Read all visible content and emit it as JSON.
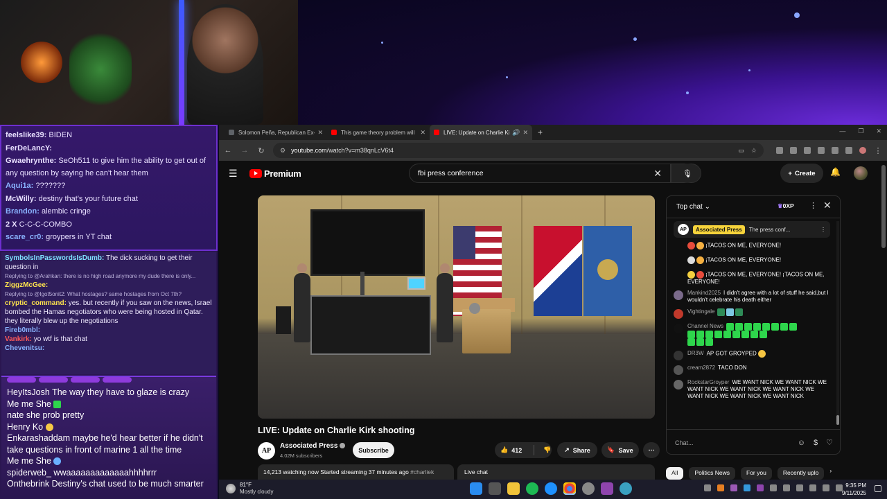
{
  "stream_chat_top": [
    {
      "user": "feelslike39:",
      "text": "BIDEN",
      "color": "#ffffff"
    },
    {
      "user": "FerDeLancY:",
      "text": "",
      "color": "#ffffff"
    },
    {
      "user": "Gwaehrynthe:",
      "text": "SeOh511 to give him the ability to get out of any question by saying he can't hear them",
      "color": "#ffffff"
    },
    {
      "user": "Aqui1a:",
      "text": "???????",
      "color": "#8ab4ff"
    },
    {
      "user": "McWilly:",
      "text": "destiny that's your future chat",
      "color": "#ffffff"
    },
    {
      "user": "Brandon:",
      "text": "alembic cringe",
      "color": "#8ab4ff"
    },
    {
      "user": "2 X",
      "text": "C-C-C-COMBO",
      "color": "#ffffff"
    },
    {
      "user": "scare_cr0:",
      "text": "groypers in YT chat",
      "color": "#8ab4ff"
    }
  ],
  "stream_chat_mid": [
    {
      "user": "SymbolsInPasswordsIsDumb:",
      "text": "The dick sucking to get their question in",
      "color": "#7fe0ff"
    },
    {
      "reply": "Replying to @Arahkan: there is no high road anymore my dude there is only..."
    },
    {
      "user": "ZiggzMcGee:",
      "text": "",
      "color": "#ffe44d"
    },
    {
      "reply": "Replying to @Igot5onit2: What hostages? same hostages from Oct 7th?"
    },
    {
      "user": "cryptic_command:",
      "text": "yes. but recently if you saw on the news, Israel bombed the Hamas negotiators who were being hosted in Qatar. they literally blew up the negotiations",
      "color": "#ffe44d"
    },
    {
      "user": "Fireb0mbl:",
      "text": "",
      "color": "#8ab4ff"
    },
    {
      "user": "Vankirk:",
      "text": "yo wtf is that chat",
      "color": "#ff5a5a"
    },
    {
      "user": "Chevenitsu:",
      "text": "",
      "color": "#8ab4ff"
    }
  ],
  "stream_chat_bottom": [
    {
      "user": "HeyItsJosh",
      "text": "The way they have to glaze is crazy"
    },
    {
      "user": "Me me She",
      "text": ""
    },
    {
      "user": "nate",
      "text": "she prob pretty"
    },
    {
      "user": "Henry Ko",
      "text": ""
    },
    {
      "user": "Enkarashaddam",
      "text": "maybe he'd hear better if he didn't take questions in front of marine 1 all the time"
    },
    {
      "user": "Me me She",
      "text": ""
    },
    {
      "user": "spiderweb_",
      "text": "wwaaaaaaaaaaaaahhhhrrr"
    },
    {
      "user": "Onthebrink",
      "text": "Destiny's chat used to be much smarter"
    }
  ],
  "tabs": [
    {
      "title": "Solomon Peña, Republican Ex-C",
      "favicon_color": "#5f6368"
    },
    {
      "title": "This game theory problem will",
      "favicon_color": "#ff0000"
    },
    {
      "title": "LIVE: Update on Charlie Kirk",
      "favicon_color": "#ff0000"
    }
  ],
  "url": {
    "site": "youtube.com",
    "path": "/watch?v=m38qnLcV6t4"
  },
  "youtube": {
    "logo_text": "Premium",
    "search_value": "fbi press conference",
    "create_label": "Create",
    "video_title": "LIVE: Update on Charlie Kirk shooting",
    "channel_name": "Associated Press",
    "channel_logo": "AP",
    "subscribers": "4.02M subscribers",
    "subscribe_label": "Subscribe",
    "likes": "412",
    "share_label": "Share",
    "save_label": "Save",
    "description": "14,213 watching now  Started streaming 37 minutes ago",
    "description_tag": "#charliek",
    "live_chat_label": "Live chat",
    "chips": [
      "All",
      "Politics News",
      "For you",
      "Recently uplo"
    ]
  },
  "live_chat": {
    "mode": "Top chat",
    "xp": "0XP",
    "pinned_name": "Associated Press",
    "pinned_text": "The press conf...",
    "messages": [
      {
        "user": "",
        "text": "¡TACOS ON ME, EVERYONE!",
        "avatar": "#0f0f0f"
      },
      {
        "user": "",
        "text": "¡TACOS ON ME, EVERYONE!",
        "avatar": "#0f0f0f"
      },
      {
        "user": "",
        "text": "¡TACOS ON ME, EVERYONE! ¡TACOS ON ME, EVERYONE!",
        "avatar": "#0f0f0f"
      },
      {
        "user": "Mankind2025",
        "text": "I didn't agree with a lot of stuff he said,but I wouldn't celebrate his death either",
        "avatar": "#7a6a8a"
      },
      {
        "user": "Vightingale",
        "text": "",
        "avatar": "#c0392b"
      },
      {
        "user": "Channel News",
        "text": "",
        "avatar": "#111111"
      },
      {
        "user": "DR3W",
        "text": "AP GOT GROYPED",
        "avatar": "#333333"
      },
      {
        "user": "cream2872",
        "text": "TACO DON",
        "avatar": "#555555"
      },
      {
        "user": "RockstarGroyper",
        "text": "WE WANT NICK WE WANT NICK WE WANT NICK WE WANT NICK WE WANT NICK WE WANT NICK WE WANT NICK WE WANT NICK",
        "avatar": "#666666"
      }
    ],
    "input_placeholder": "Chat..."
  },
  "taskbar": {
    "temp": "81°F",
    "weather": "Mostly cloudy",
    "time": "9:35 PM",
    "date": "9/11/2025"
  }
}
